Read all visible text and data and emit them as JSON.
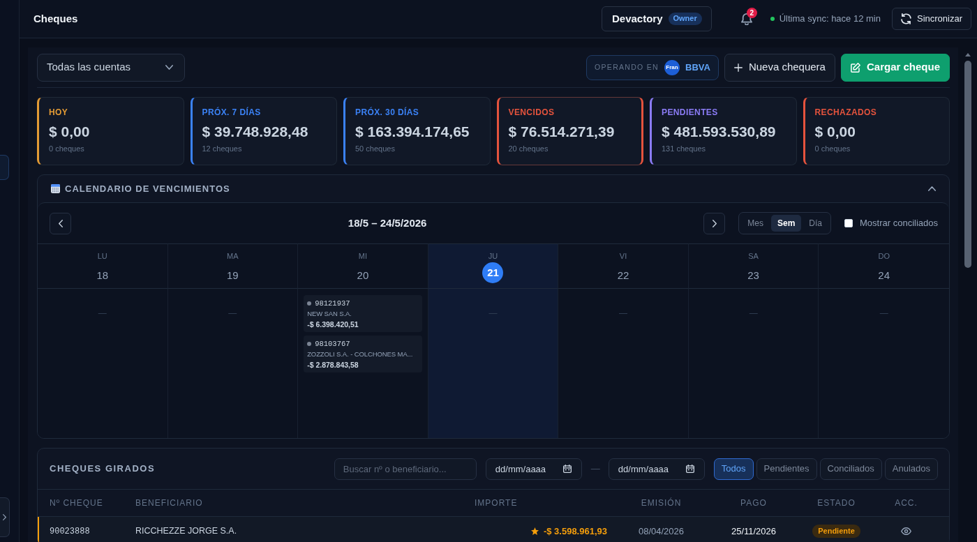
{
  "header": {
    "title": "Cheques",
    "workspace": {
      "name": "Devactory",
      "role": "Owner"
    },
    "notifications": {
      "count": "2"
    },
    "sync": {
      "connected": true,
      "text": "Última sync: hace 12 min"
    },
    "sync_button": {
      "label": "Sincronizar"
    }
  },
  "toolbar": {
    "account_select": {
      "value": "Todas las cuentas"
    },
    "operating_in": {
      "label": "OPERANDO EN",
      "avatar": "Fran",
      "bank": "BBVA"
    },
    "buttons": [
      {
        "label": "Nueva chequera",
        "kind": "secondary"
      },
      {
        "label": "Cargar cheque",
        "kind": "primary"
      }
    ]
  },
  "summary_cards": [
    {
      "label": "HOY",
      "amount": "$ 0,00",
      "count": "0 cheques",
      "color": "#e39b35",
      "selected": false
    },
    {
      "label": "PRÓX. 7 DÍAS",
      "amount": "$ 39.748.928,48",
      "count": "12 cheques",
      "color": "#3b82f6",
      "selected": false
    },
    {
      "label": "PRÓX. 30 DÍAS",
      "amount": "$ 163.394.174,65",
      "count": "50 cheques",
      "color": "#3b82f6",
      "selected": false
    },
    {
      "label": "VENCIDOS",
      "amount": "$ 76.514.271,39",
      "count": "20 cheques",
      "color": "#e5533d",
      "selected": true
    },
    {
      "label": "PENDIENTES",
      "amount": "$ 481.593.530,89",
      "count": "131 cheques",
      "color": "#8b7cf6",
      "selected": false
    },
    {
      "label": "RECHAZADOS",
      "amount": "$ 0,00",
      "count": "0 cheques",
      "color": "#e5533d",
      "selected": false
    }
  ],
  "calendar": {
    "title": "CALENDARIO DE VENCIMIENTOS",
    "expanded": true,
    "range": "18/5 – 24/5/2026",
    "views": [
      {
        "label": "Mes",
        "selected": false
      },
      {
        "label": "Sem",
        "selected": true
      },
      {
        "label": "Día",
        "selected": false
      }
    ],
    "show_reconciled": {
      "label": "Mostrar conciliados",
      "checked": false
    },
    "days": [
      {
        "weekday": "LU",
        "date": "18",
        "today": false,
        "empty_mark": "—"
      },
      {
        "weekday": "MA",
        "date": "19",
        "today": false,
        "empty_mark": "—"
      },
      {
        "weekday": "MI",
        "date": "20",
        "today": false,
        "events": [
          {
            "number": "98121937",
            "payee": "NEW SAN S.A.",
            "amount": "-$ 6.398.420,51"
          },
          {
            "number": "98103767",
            "payee": "ZOZZOLI S.A. - COLCHONES MA...",
            "amount": "-$ 2.878.843,58"
          }
        ]
      },
      {
        "weekday": "JU",
        "date": "21",
        "today": true,
        "empty_mark": "—"
      },
      {
        "weekday": "VI",
        "date": "22",
        "today": false,
        "empty_mark": "—"
      },
      {
        "weekday": "SA",
        "date": "23",
        "today": false,
        "empty_mark": "—"
      },
      {
        "weekday": "DO",
        "date": "24",
        "today": false,
        "empty_mark": "—"
      }
    ]
  },
  "cheques_table": {
    "title": "CHEQUES GIRADOS",
    "search": {
      "placeholder": "Buscar nº o beneficiario..."
    },
    "date_from": {
      "placeholder": "dd/mm/aaaa"
    },
    "range_separator": "—",
    "date_to": {
      "placeholder": "dd/mm/aaaa"
    },
    "filters": [
      {
        "label": "Todos",
        "selected": true
      },
      {
        "label": "Pendientes",
        "selected": false
      },
      {
        "label": "Conciliados",
        "selected": false
      },
      {
        "label": "Anulados",
        "selected": false
      }
    ],
    "columns": [
      "Nº CHEQUE",
      "BENEFICIARIO",
      "IMPORTE",
      "EMISIÓN",
      "PAGO",
      "ESTADO",
      "ACC."
    ],
    "rows": [
      {
        "number": "90023888",
        "payee": "RICCHEZZE JORGE S.A.",
        "starred": true,
        "amount": "-$ 3.598.961,93",
        "issued": "08/04/2026",
        "payment": "25/11/2026",
        "status": {
          "label": "Pendiente",
          "kind": "pending"
        }
      }
    ]
  }
}
